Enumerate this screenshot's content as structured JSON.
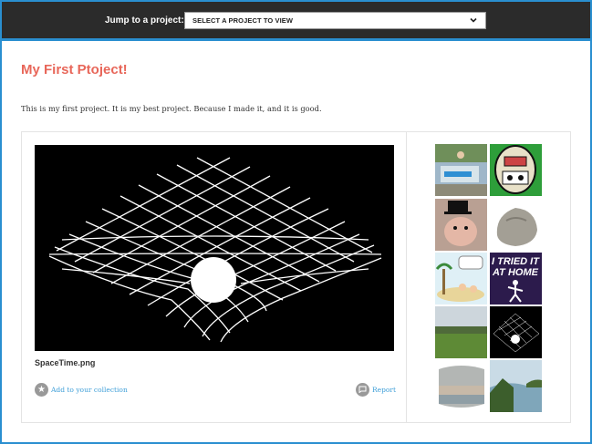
{
  "nav": {
    "jump_label": "Jump to a project:",
    "select_value": "SELECT A PROJECT TO VIEW"
  },
  "project": {
    "title": "My First Ptoject!",
    "description": "This is my first project. It is my best project. Because I made it, and it is good."
  },
  "media": {
    "filename": "SpaceTime.png",
    "add_collection_label": "Add to your collection",
    "report_label": "Report"
  },
  "thumbnails": {
    "tried_text_line1": "I TRIED IT",
    "tried_text_line2": "AT HOME"
  },
  "colors": {
    "accent": "#e8675a",
    "link": "#3f9fd8",
    "topbar": "#2b2b2b",
    "border": "#2a8fd0"
  }
}
